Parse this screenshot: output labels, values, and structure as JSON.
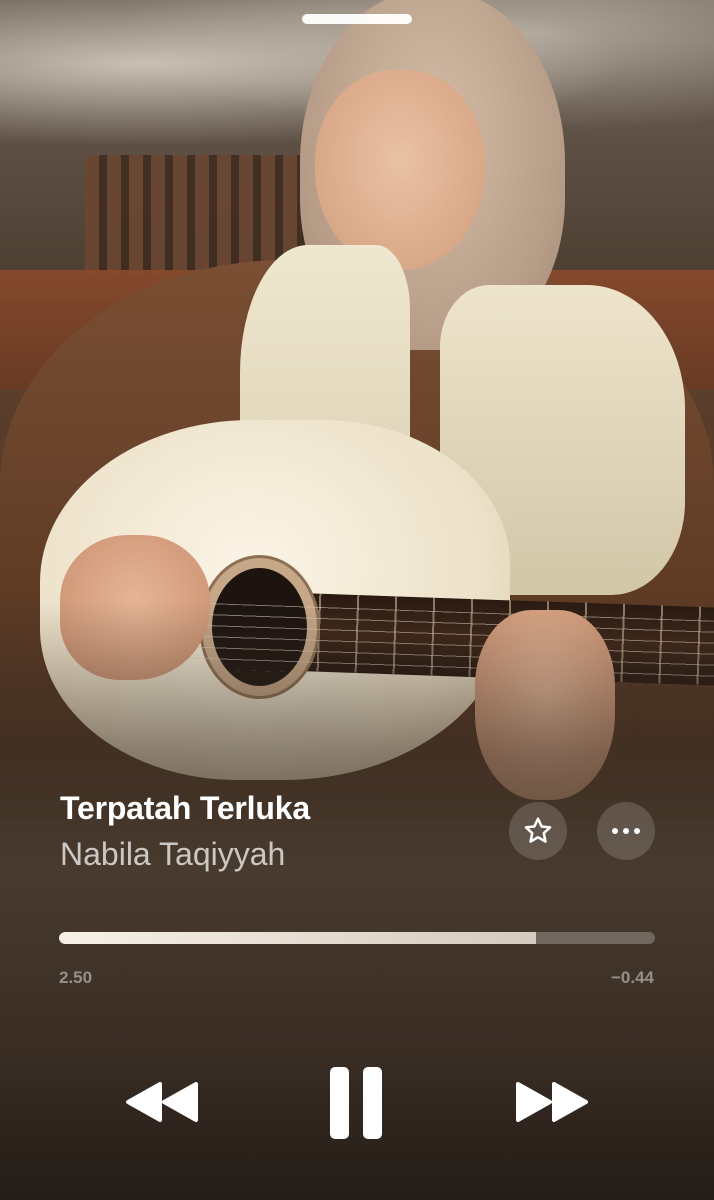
{
  "artwork": {
    "icon": "album-art-guitar-photo"
  },
  "track": {
    "title": "Terpatah Terluka",
    "artist": "Nabila Taqiyyah"
  },
  "playback": {
    "elapsed": "2.50",
    "remaining": "−0.44",
    "progress_fraction": 0.8,
    "state": "playing"
  },
  "icons": {
    "favorite": "star-outline-icon",
    "more": "ellipsis-icon",
    "rewind": "rewind-icon",
    "pause": "pause-icon",
    "forward": "fast-forward-icon"
  },
  "colors": {
    "text_primary": "#ffffff",
    "text_secondary": "rgba(255,255,255,0.72)",
    "progress_fill": "#f5efe6",
    "progress_track": "rgba(255,255,255,0.25)"
  }
}
